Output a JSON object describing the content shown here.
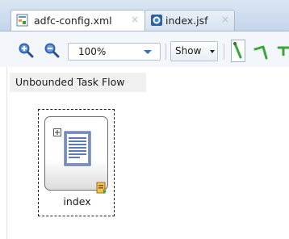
{
  "tabs": [
    {
      "label": "adfc-config.xml",
      "icon": "xml-config-file-icon",
      "active": true,
      "close": "×"
    },
    {
      "label": "index.jsf",
      "icon": "jsf-page-icon",
      "active": false,
      "close": "×"
    }
  ],
  "toolbar": {
    "zoom_in_icon": "zoom-in-icon",
    "zoom_out_icon": "zoom-out-icon",
    "zoom_value": "100%",
    "show_label": "Show",
    "tool_icons": [
      "control-flow-case-icon",
      "wildcard-control-flow-icon",
      "more-tools-icon"
    ]
  },
  "canvas": {
    "flow_type_label": "Unbounded Task Flow",
    "activity": {
      "label": "index",
      "icon": "view-activity-page-icon",
      "badges": [
        "expand-icon",
        "default-activity-icon"
      ]
    }
  },
  "colors": {
    "tab_bar": "#c4d5ea",
    "toolbar": "#f3f6fa",
    "accent_green": "#3aa635",
    "zoom_blue": "#2f66b3"
  }
}
